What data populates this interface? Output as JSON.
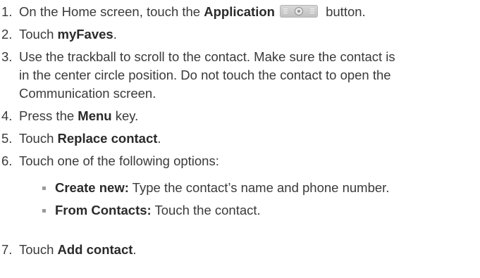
{
  "steps": [
    {
      "num": "1.",
      "pre": "On the Home screen, touch the ",
      "bold": "Application",
      "icon": "application-button-icon",
      "post": " button."
    },
    {
      "num": "2.",
      "pre": "Touch ",
      "bold": "myFaves",
      "post": "."
    },
    {
      "num": "3.",
      "lines": [
        "Use the trackball to scroll to the contact. Make sure the contact is",
        "in the center circle position. Do not touch the contact to open the",
        "Communication screen."
      ]
    },
    {
      "num": "4.",
      "pre": "Press the ",
      "bold": "Menu",
      "post": " key."
    },
    {
      "num": "5.",
      "pre": "Touch ",
      "bold": "Replace contact",
      "post": "."
    },
    {
      "num": "6.",
      "text": "Touch one of the following options:"
    },
    {
      "num": "7.",
      "pre": "Touch ",
      "bold": "Add contact",
      "post": "."
    }
  ],
  "options": [
    {
      "bold": "Create new:",
      "text": " Type the contact’s name and phone number."
    },
    {
      "bold": "From Contacts:",
      "text": " Touch the contact."
    }
  ]
}
